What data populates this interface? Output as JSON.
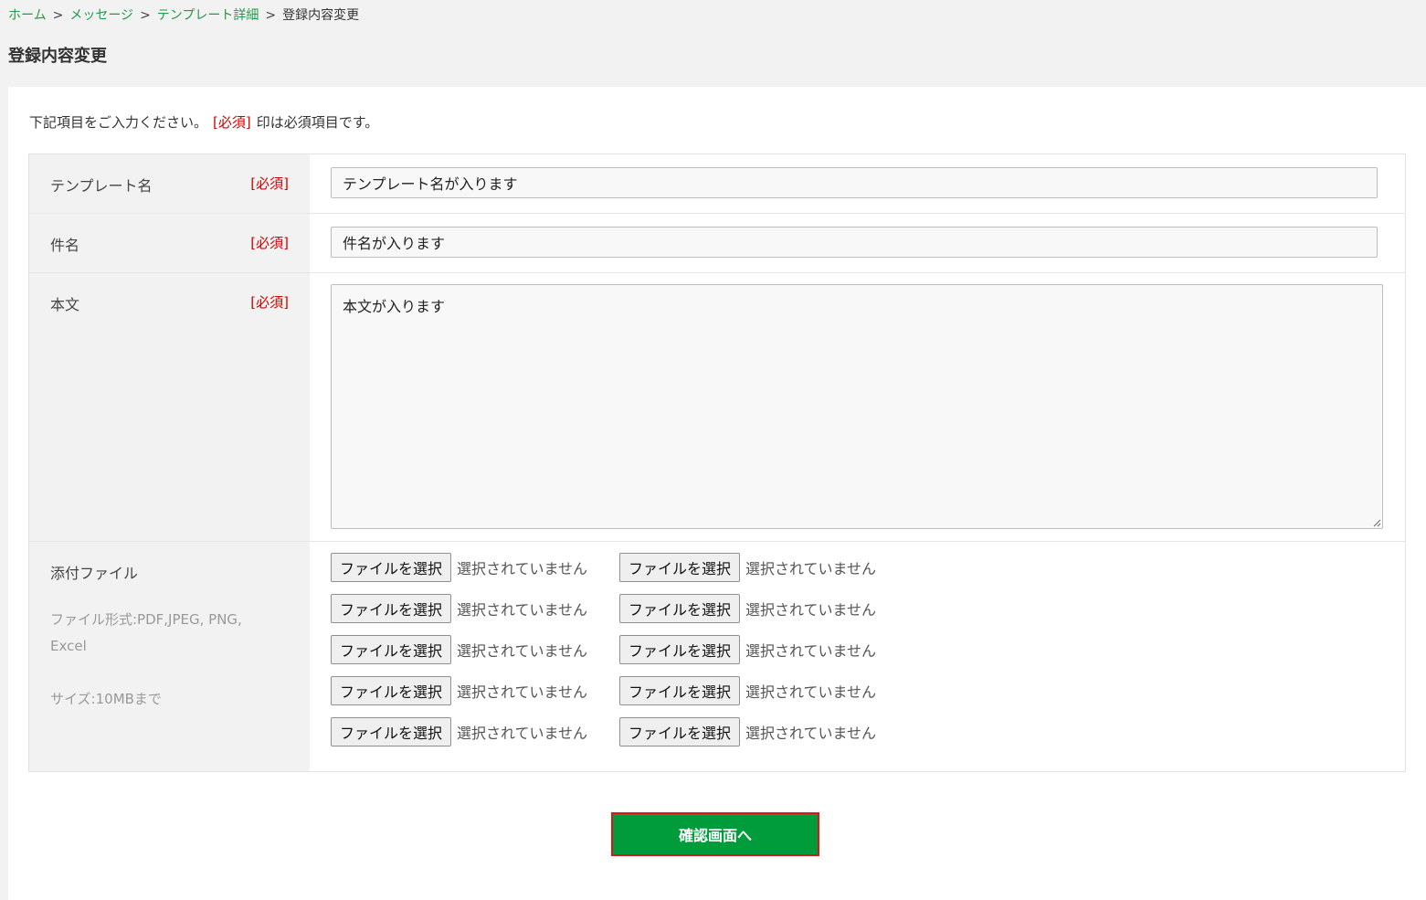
{
  "breadcrumb": {
    "home": "ホーム",
    "messages": "メッセージ",
    "template_detail": "テンプレート詳細",
    "current": "登録内容変更",
    "separator": ">"
  },
  "page_title": "登録内容変更",
  "intro": {
    "before": "下記項目をご入力ください。",
    "required_mark": "[必須]",
    "after": "印は必須項目です。"
  },
  "required_label": "[必須]",
  "form": {
    "template_name": {
      "label": "テンプレート名",
      "value": "テンプレート名が入ります"
    },
    "subject": {
      "label": "件名",
      "value": "件名が入ります"
    },
    "body": {
      "label": "本文",
      "value": "本文が入ります"
    },
    "attachments": {
      "label": "添付ファイル",
      "formats": "ファイル形式:PDF,JPEG, PNG, Excel",
      "size": "サイズ:10MBまで",
      "button_label": "ファイルを選択",
      "status": "選択されていません"
    }
  },
  "confirm_button": "確認画面へ",
  "colors": {
    "link": "#1f9a46",
    "required": "#d40000",
    "primary_button": "#009b3a",
    "button_border": "#e0141e"
  }
}
